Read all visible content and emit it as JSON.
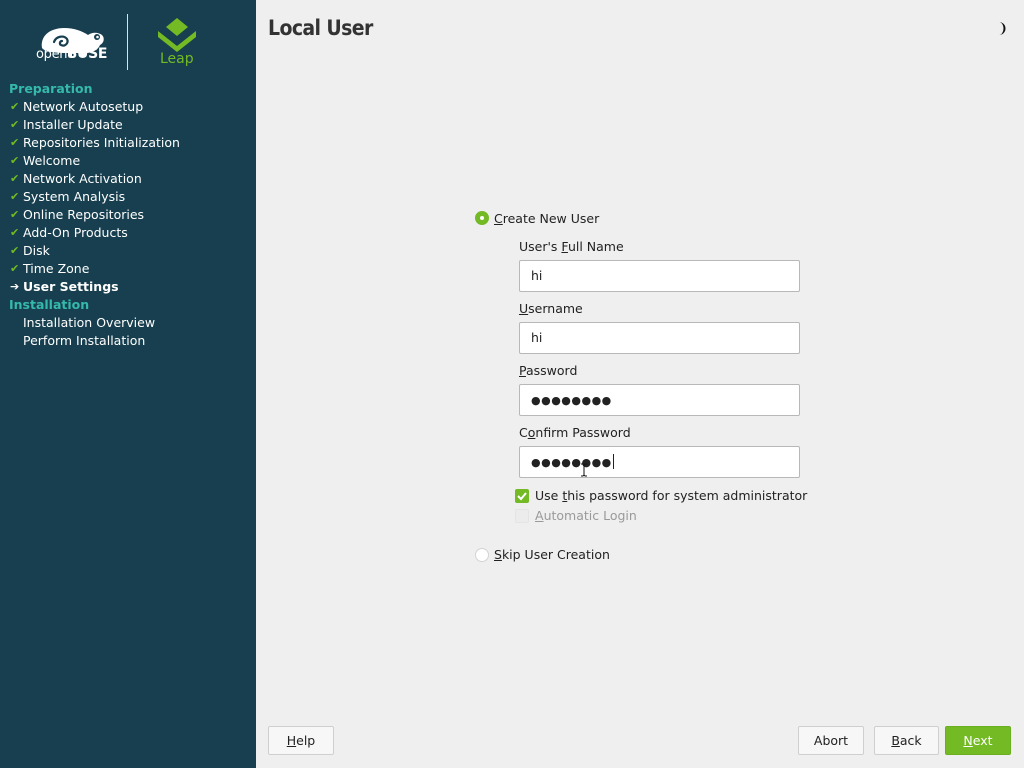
{
  "brand": {
    "opensuse_prefix": "open",
    "opensuse_suffix": "SUSE",
    "leap": "Leap",
    "sidebar_bg": "#173f4f",
    "accent_green": "#73ba25",
    "section_teal": "#35b9ab"
  },
  "sidebar": {
    "sections": [
      {
        "title": "Preparation",
        "steps": [
          {
            "label": "Network Autosetup",
            "status": "done"
          },
          {
            "label": "Installer Update",
            "status": "done"
          },
          {
            "label": "Repositories Initialization",
            "status": "done"
          },
          {
            "label": "Welcome",
            "status": "done"
          },
          {
            "label": "Network Activation",
            "status": "done"
          },
          {
            "label": "System Analysis",
            "status": "done"
          },
          {
            "label": "Online Repositories",
            "status": "done"
          },
          {
            "label": "Add-On Products",
            "status": "done"
          },
          {
            "label": "Disk",
            "status": "done"
          },
          {
            "label": "Time Zone",
            "status": "done"
          },
          {
            "label": "User Settings",
            "status": "current"
          }
        ]
      },
      {
        "title": "Installation",
        "steps": [
          {
            "label": "Installation Overview",
            "status": "pending"
          },
          {
            "label": "Perform Installation",
            "status": "pending"
          }
        ]
      }
    ]
  },
  "page": {
    "title": "Local User",
    "theme_toggle_icon": "half-moon-icon"
  },
  "form": {
    "create_user": {
      "label_pre": "",
      "label_key": "C",
      "label_post": "reate New User",
      "selected": true
    },
    "full_name": {
      "label_pre": "User's ",
      "label_key": "F",
      "label_post": "ull Name",
      "value": "hi"
    },
    "username": {
      "label_pre": "",
      "label_key": "U",
      "label_post": "sername",
      "value": "hi"
    },
    "password": {
      "label_pre": "",
      "label_key": "P",
      "label_post": "assword",
      "value": "●●●●●●●●"
    },
    "confirm_password": {
      "label_pre": "C",
      "label_key": "o",
      "label_post": "nfirm Password",
      "value": "●●●●●●●●"
    },
    "use_for_admin": {
      "label_pre": "Use ",
      "label_key": "t",
      "label_post": "his password for system administrator",
      "checked": true
    },
    "auto_login": {
      "label_pre": "",
      "label_key": "A",
      "label_post": "utomatic Login",
      "checked": false,
      "disabled": true
    },
    "skip_user": {
      "label_pre": "",
      "label_key": "S",
      "label_post": "kip User Creation",
      "selected": false
    }
  },
  "footer": {
    "help": {
      "key": "H",
      "rest": "elp"
    },
    "abort": {
      "key": "",
      "rest": "Abort"
    },
    "back": {
      "key": "B",
      "rest": "ack"
    },
    "next": {
      "key": "N",
      "rest": "ext"
    }
  }
}
